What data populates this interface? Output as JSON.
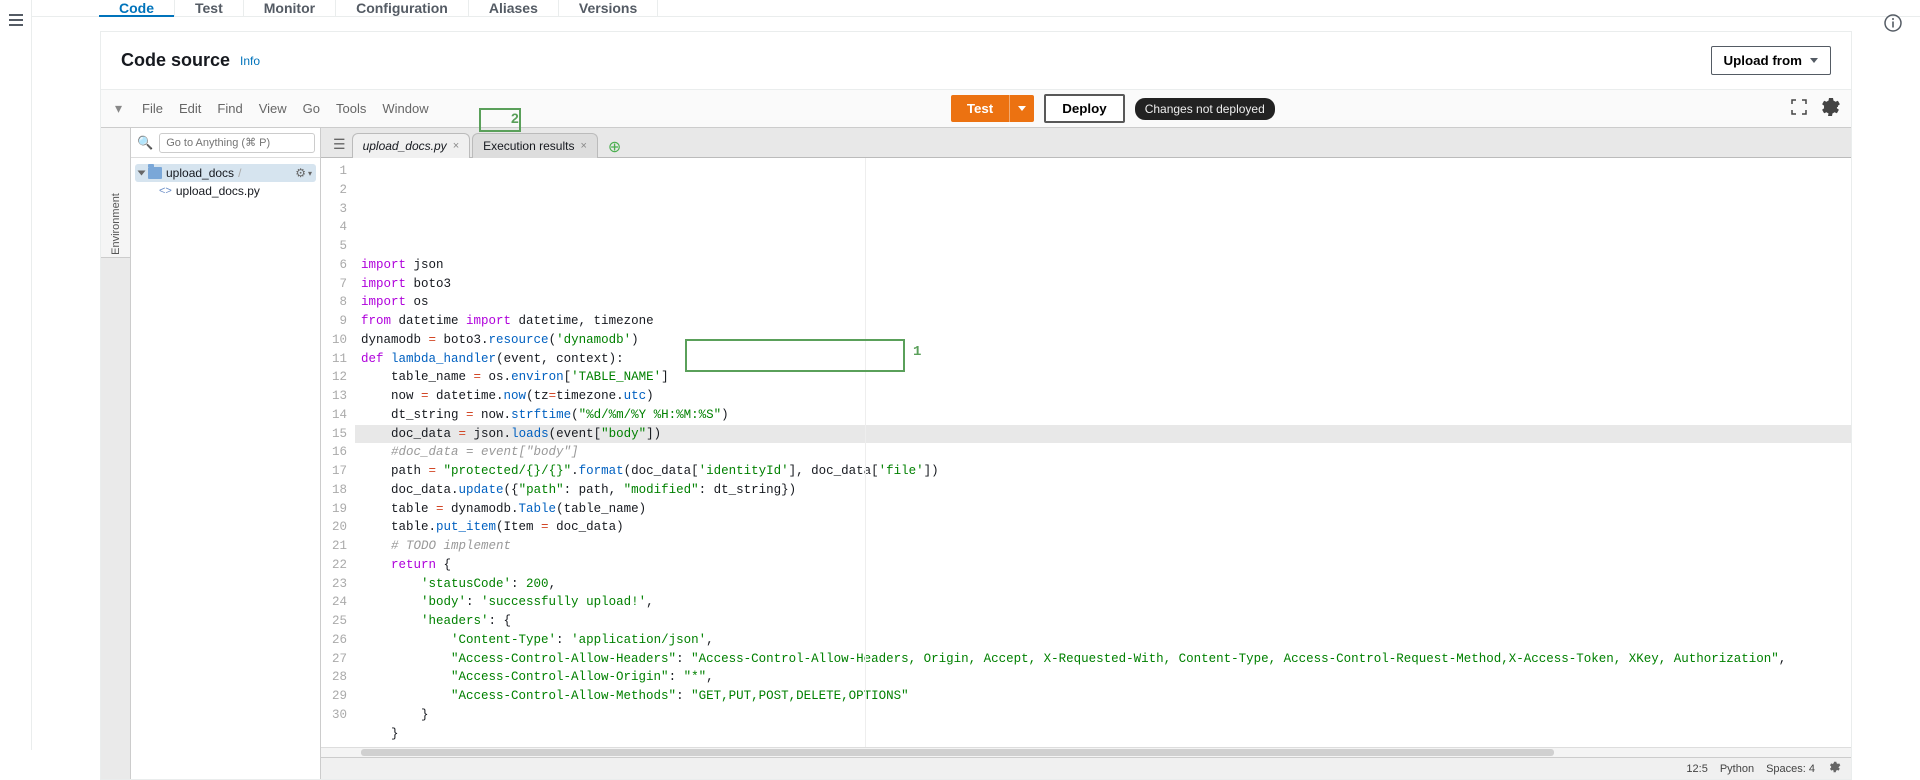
{
  "top_tabs": [
    "Code",
    "Test",
    "Monitor",
    "Configuration",
    "Aliases",
    "Versions"
  ],
  "active_top_tab": "Code",
  "panel_title": "Code source",
  "info_link": "Info",
  "upload_button": "Upload from",
  "menus": [
    "File",
    "Edit",
    "Find",
    "View",
    "Go",
    "Tools",
    "Window"
  ],
  "test_button": "Test",
  "deploy_button": "Deploy",
  "changes_badge": "Changes not deployed",
  "search_placeholder": "Go to Anything (⌘ P)",
  "tree_folder": "upload_docs",
  "tree_file": "upload_docs.py",
  "editor_tabs": [
    {
      "label": "upload_docs.py",
      "active": true
    },
    {
      "label": "Execution results",
      "active": false
    }
  ],
  "lines": [
    {
      "n": 1,
      "seg": [
        [
          "kw",
          "import"
        ],
        [
          "",
          " json"
        ]
      ]
    },
    {
      "n": 2,
      "seg": [
        [
          "kw",
          "import"
        ],
        [
          "",
          " boto3"
        ]
      ]
    },
    {
      "n": 3,
      "seg": [
        [
          "kw",
          "import"
        ],
        [
          "",
          " os"
        ]
      ]
    },
    {
      "n": 4,
      "seg": [
        [
          "kw",
          "from"
        ],
        [
          "",
          " datetime "
        ],
        [
          "kw",
          "import"
        ],
        [
          "",
          " datetime, timezone"
        ]
      ]
    },
    {
      "n": 5,
      "seg": [
        [
          "",
          ""
        ]
      ]
    },
    {
      "n": 6,
      "seg": [
        [
          "",
          "dynamodb "
        ],
        [
          "op",
          "="
        ],
        [
          "",
          " boto3."
        ],
        [
          "fn",
          "resource"
        ],
        [
          "",
          "("
        ],
        [
          "str",
          "'dynamodb'"
        ],
        [
          "",
          ")"
        ]
      ]
    },
    {
      "n": 7,
      "seg": [
        [
          "",
          ""
        ]
      ]
    },
    {
      "n": 8,
      "seg": [
        [
          "kw",
          "def"
        ],
        [
          "",
          " "
        ],
        [
          "fn",
          "lambda_handler"
        ],
        [
          "",
          "(event, context):"
        ]
      ]
    },
    {
      "n": 9,
      "seg": [
        [
          "",
          "    table_name "
        ],
        [
          "op",
          "="
        ],
        [
          "",
          " os."
        ],
        [
          "fn",
          "environ"
        ],
        [
          "",
          "["
        ],
        [
          "str",
          "'TABLE_NAME'"
        ],
        [
          "",
          "]"
        ]
      ]
    },
    {
      "n": 10,
      "seg": [
        [
          "",
          "    now "
        ],
        [
          "op",
          "="
        ],
        [
          "",
          " datetime."
        ],
        [
          "fn",
          "now"
        ],
        [
          "",
          "(tz"
        ],
        [
          "op",
          "="
        ],
        [
          "",
          "timezone."
        ],
        [
          "fn",
          "utc"
        ],
        [
          "",
          ")"
        ]
      ]
    },
    {
      "n": 11,
      "seg": [
        [
          "",
          "    dt_string "
        ],
        [
          "op",
          "="
        ],
        [
          "",
          " now."
        ],
        [
          "fn",
          "strftime"
        ],
        [
          "",
          "("
        ],
        [
          "str",
          "\"%d/%m/%Y %H:%M:%S\""
        ],
        [
          "",
          ")"
        ]
      ]
    },
    {
      "n": 12,
      "hl": true,
      "seg": [
        [
          "",
          "    doc_data "
        ],
        [
          "op",
          "="
        ],
        [
          "",
          " json."
        ],
        [
          "fn",
          "loads"
        ],
        [
          "",
          "(event["
        ],
        [
          "str",
          "\"body\""
        ],
        [
          "",
          "])"
        ]
      ]
    },
    {
      "n": 13,
      "seg": [
        [
          "",
          "    "
        ],
        [
          "cmt",
          "#doc_data = event[\"body\"]"
        ]
      ]
    },
    {
      "n": 14,
      "seg": [
        [
          "",
          ""
        ]
      ]
    },
    {
      "n": 15,
      "seg": [
        [
          "",
          "    path "
        ],
        [
          "op",
          "="
        ],
        [
          "",
          " "
        ],
        [
          "str",
          "\"protected/{}/{}\""
        ],
        [
          "",
          "."
        ],
        [
          "fn",
          "format"
        ],
        [
          "",
          "(doc_data["
        ],
        [
          "str",
          "'identityId'"
        ],
        [
          "",
          "], doc_data["
        ],
        [
          "str",
          "'file'"
        ],
        [
          "",
          "])"
        ]
      ]
    },
    {
      "n": 16,
      "seg": [
        [
          "",
          "    doc_data."
        ],
        [
          "fn",
          "update"
        ],
        [
          "",
          "({"
        ],
        [
          "str",
          "\"path\""
        ],
        [
          "",
          ": path, "
        ],
        [
          "str",
          "\"modified\""
        ],
        [
          "",
          ": dt_string})"
        ]
      ]
    },
    {
      "n": 17,
      "seg": [
        [
          "",
          "    table "
        ],
        [
          "op",
          "="
        ],
        [
          "",
          " dynamodb."
        ],
        [
          "fn",
          "Table"
        ],
        [
          "",
          "(table_name)"
        ]
      ]
    },
    {
      "n": 18,
      "seg": [
        [
          "",
          "    table."
        ],
        [
          "fn",
          "put_item"
        ],
        [
          "",
          "(Item "
        ],
        [
          "op",
          "="
        ],
        [
          "",
          " doc_data)"
        ]
      ]
    },
    {
      "n": 19,
      "seg": [
        [
          "",
          ""
        ]
      ]
    },
    {
      "n": 20,
      "seg": [
        [
          "",
          "    "
        ],
        [
          "cmt",
          "# TODO implement"
        ]
      ]
    },
    {
      "n": 21,
      "seg": [
        [
          "",
          "    "
        ],
        [
          "kw",
          "return"
        ],
        [
          "",
          " {"
        ]
      ]
    },
    {
      "n": 22,
      "seg": [
        [
          "",
          "        "
        ],
        [
          "str",
          "'statusCode'"
        ],
        [
          "",
          ": "
        ],
        [
          "num",
          "200"
        ],
        [
          "",
          ","
        ]
      ]
    },
    {
      "n": 23,
      "seg": [
        [
          "",
          "        "
        ],
        [
          "str",
          "'body'"
        ],
        [
          "",
          ": "
        ],
        [
          "str",
          "'successfully upload!'"
        ],
        [
          "",
          ","
        ]
      ]
    },
    {
      "n": 24,
      "seg": [
        [
          "",
          "        "
        ],
        [
          "str",
          "'headers'"
        ],
        [
          "",
          ": {"
        ]
      ]
    },
    {
      "n": 25,
      "seg": [
        [
          "",
          "            "
        ],
        [
          "str",
          "'Content-Type'"
        ],
        [
          "",
          ": "
        ],
        [
          "str",
          "'application/json'"
        ],
        [
          "",
          ","
        ]
      ]
    },
    {
      "n": 26,
      "seg": [
        [
          "",
          "            "
        ],
        [
          "str",
          "\"Access-Control-Allow-Headers\""
        ],
        [
          "",
          ": "
        ],
        [
          "str",
          "\"Access-Control-Allow-Headers, Origin, Accept, X-Requested-With, Content-Type, Access-Control-Request-Method,X-Access-Token, XKey, Authorization\""
        ],
        [
          "",
          ","
        ]
      ]
    },
    {
      "n": 27,
      "seg": [
        [
          "",
          "            "
        ],
        [
          "str",
          "\"Access-Control-Allow-Origin\""
        ],
        [
          "",
          ": "
        ],
        [
          "str",
          "\"*\""
        ],
        [
          "",
          ","
        ]
      ]
    },
    {
      "n": 28,
      "seg": [
        [
          "",
          "            "
        ],
        [
          "str",
          "\"Access-Control-Allow-Methods\""
        ],
        [
          "",
          ": "
        ],
        [
          "str",
          "\"GET,PUT,POST,DELETE,OPTIONS\""
        ]
      ]
    },
    {
      "n": 29,
      "seg": [
        [
          "",
          "        }"
        ]
      ]
    },
    {
      "n": 30,
      "seg": [
        [
          "",
          "    }"
        ]
      ]
    }
  ],
  "callouts": {
    "1": "1",
    "2": "2"
  },
  "status_bar": {
    "pos": "12:5",
    "lang": "Python",
    "spaces": "Spaces: 4"
  },
  "env_label": "Environment"
}
